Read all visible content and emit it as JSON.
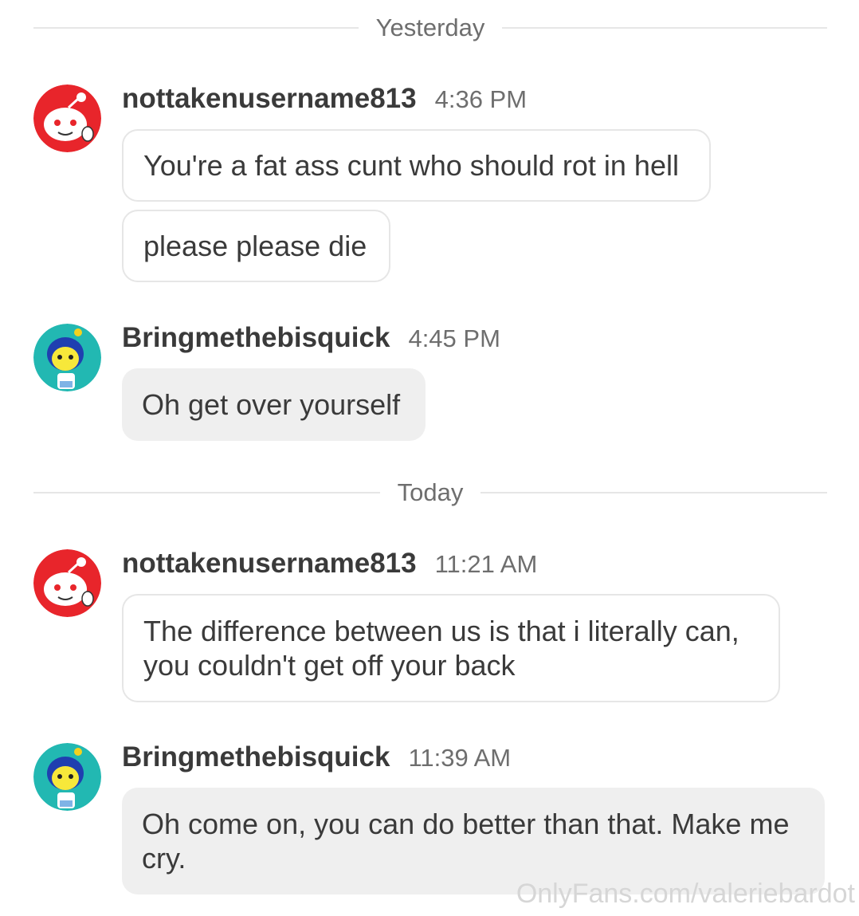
{
  "dividers": {
    "yesterday": "Yesterday",
    "today": "Today"
  },
  "messages": [
    {
      "username": "nottakenusername813",
      "time": "4:36 PM",
      "bubbles": [
        "You're a fat ass cunt who should rot in hell",
        "please please die"
      ]
    },
    {
      "username": "Bringmethebisquick",
      "time": "4:45 PM",
      "bubbles": [
        "Oh get over yourself"
      ]
    },
    {
      "username": "nottakenusername813",
      "time": "11:21 AM",
      "bubbles": [
        "The difference between us is that i literally can, you couldn't get off your back"
      ]
    },
    {
      "username": "Bringmethebisquick",
      "time": "11:39 AM",
      "bubbles": [
        "Oh come on, you can do better than that. Make me cry."
      ]
    }
  ],
  "avatars": {
    "red_user": "reddit-snoo-red-icon",
    "teal_user": "reddit-snoo-blue-hair-icon"
  },
  "colors": {
    "red_avatar": "#e8252b",
    "teal_avatar": "#22b8b2",
    "filled_bubble": "#efefef",
    "outline_bubble_border": "#e6e6e6"
  },
  "watermark": "OnlyFans.com/valeriebardot"
}
